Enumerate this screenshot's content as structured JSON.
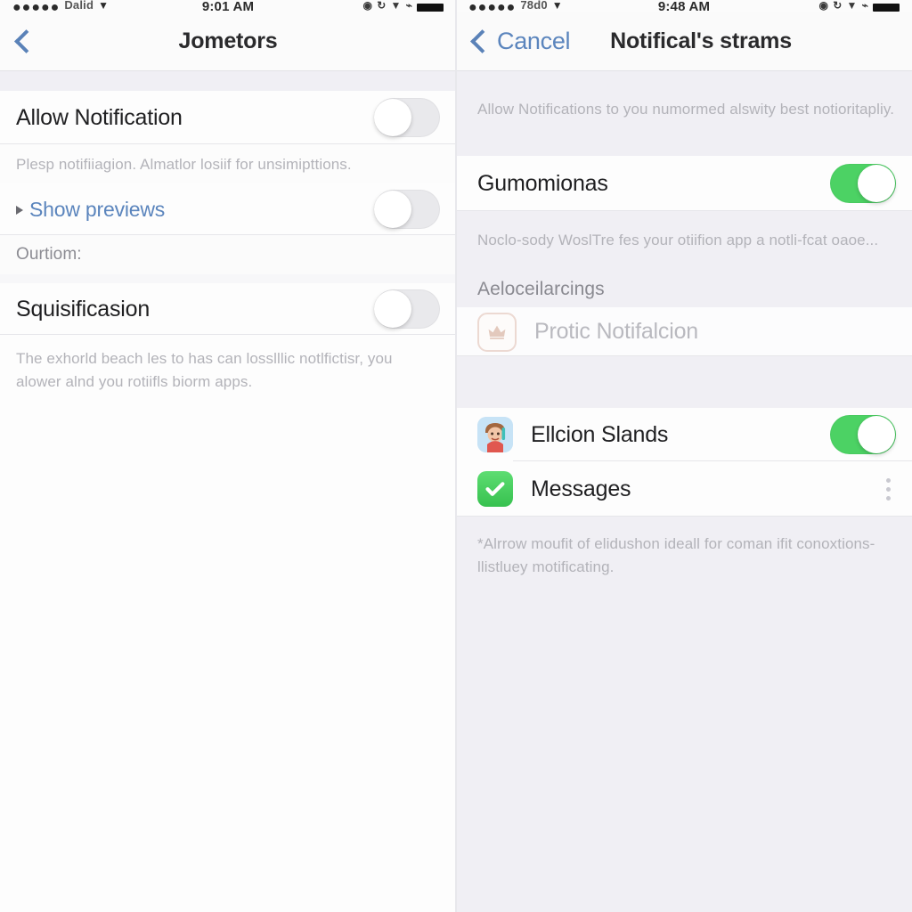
{
  "left_panel": {
    "status_bar": {
      "signal_dots": "●●●●●",
      "carrier": "Dalid",
      "wifi_icon": "wifi-icon",
      "time": "9:01 AM",
      "alarm_icon": "alarm-icon",
      "lock_icon": "rotation-lock-icon",
      "bluetooth_icon": "bluetooth-icon",
      "battery_label": "battery-icon"
    },
    "nav": {
      "back_icon": "chevron-left-icon",
      "back_label": "",
      "title": "Jometors"
    },
    "rows": [
      {
        "name": "allow-notification",
        "label": "Allow Notification",
        "toggle": "off",
        "footnote": "Plesp notifiiagion. Almatlor losiif for unsimipttions."
      },
      {
        "name": "show-previews",
        "label": "Show previews",
        "toggle": "off",
        "is_link": true,
        "has_triangle": true
      }
    ],
    "section_header": "Ourtiom:",
    "rows2": [
      {
        "name": "squisificasion",
        "label": "Squisificasion",
        "toggle": "off"
      }
    ],
    "footer_note": "The exhorld beach les to has can losslllic notlfictisr, you alower alnd you rotiifls biorm apps."
  },
  "right_panel": {
    "status_bar": {
      "signal_dots": "●●●●●",
      "carrier": "78d0",
      "wifi_icon": "wifi-icon",
      "time": "9:48 AM",
      "alarm_icon": "alarm-icon",
      "lock_icon": "rotation-lock-icon",
      "bluetooth_icon": "bluetooth-icon",
      "battery_label": "battery-icon"
    },
    "nav": {
      "back_icon": "chevron-left-icon",
      "cancel_label": "Cancel",
      "title": "Notifical's strams"
    },
    "intro_note": "Allow Notifications to you numormed alswity best notioritapliy.",
    "main_row": {
      "name": "gumomionas",
      "label": "Gumomionas",
      "toggle": "on",
      "footnote": "Noclo-sody WoslTre fes your otiifion app a notli-fcat oaoe..."
    },
    "section_header": "Aeloceilarcings",
    "ghost_row": {
      "name": "protic-notification",
      "label": "Protic Notifalcion",
      "icon": "crown-icon"
    },
    "app_rows": [
      {
        "name": "ellcion-slands",
        "label": "Ellcion Slands",
        "icon": "avatar-icon",
        "toggle": "on"
      },
      {
        "name": "messages",
        "label": "Messages",
        "icon": "checkmark-icon",
        "menu": "more-options-icon"
      }
    ],
    "footer_note": "*Alrrow moufit of elidushon ideall for coman ifit conoxtions-llistluey motificating."
  },
  "colors": {
    "accent_blue": "#5b85bd",
    "toggle_on_green": "#4cd264",
    "toggle_off_gray": "#e9e9ec",
    "group_background": "#f0eff4",
    "row_background": "#fdfdfd",
    "muted_text": "#b3b3b9"
  }
}
